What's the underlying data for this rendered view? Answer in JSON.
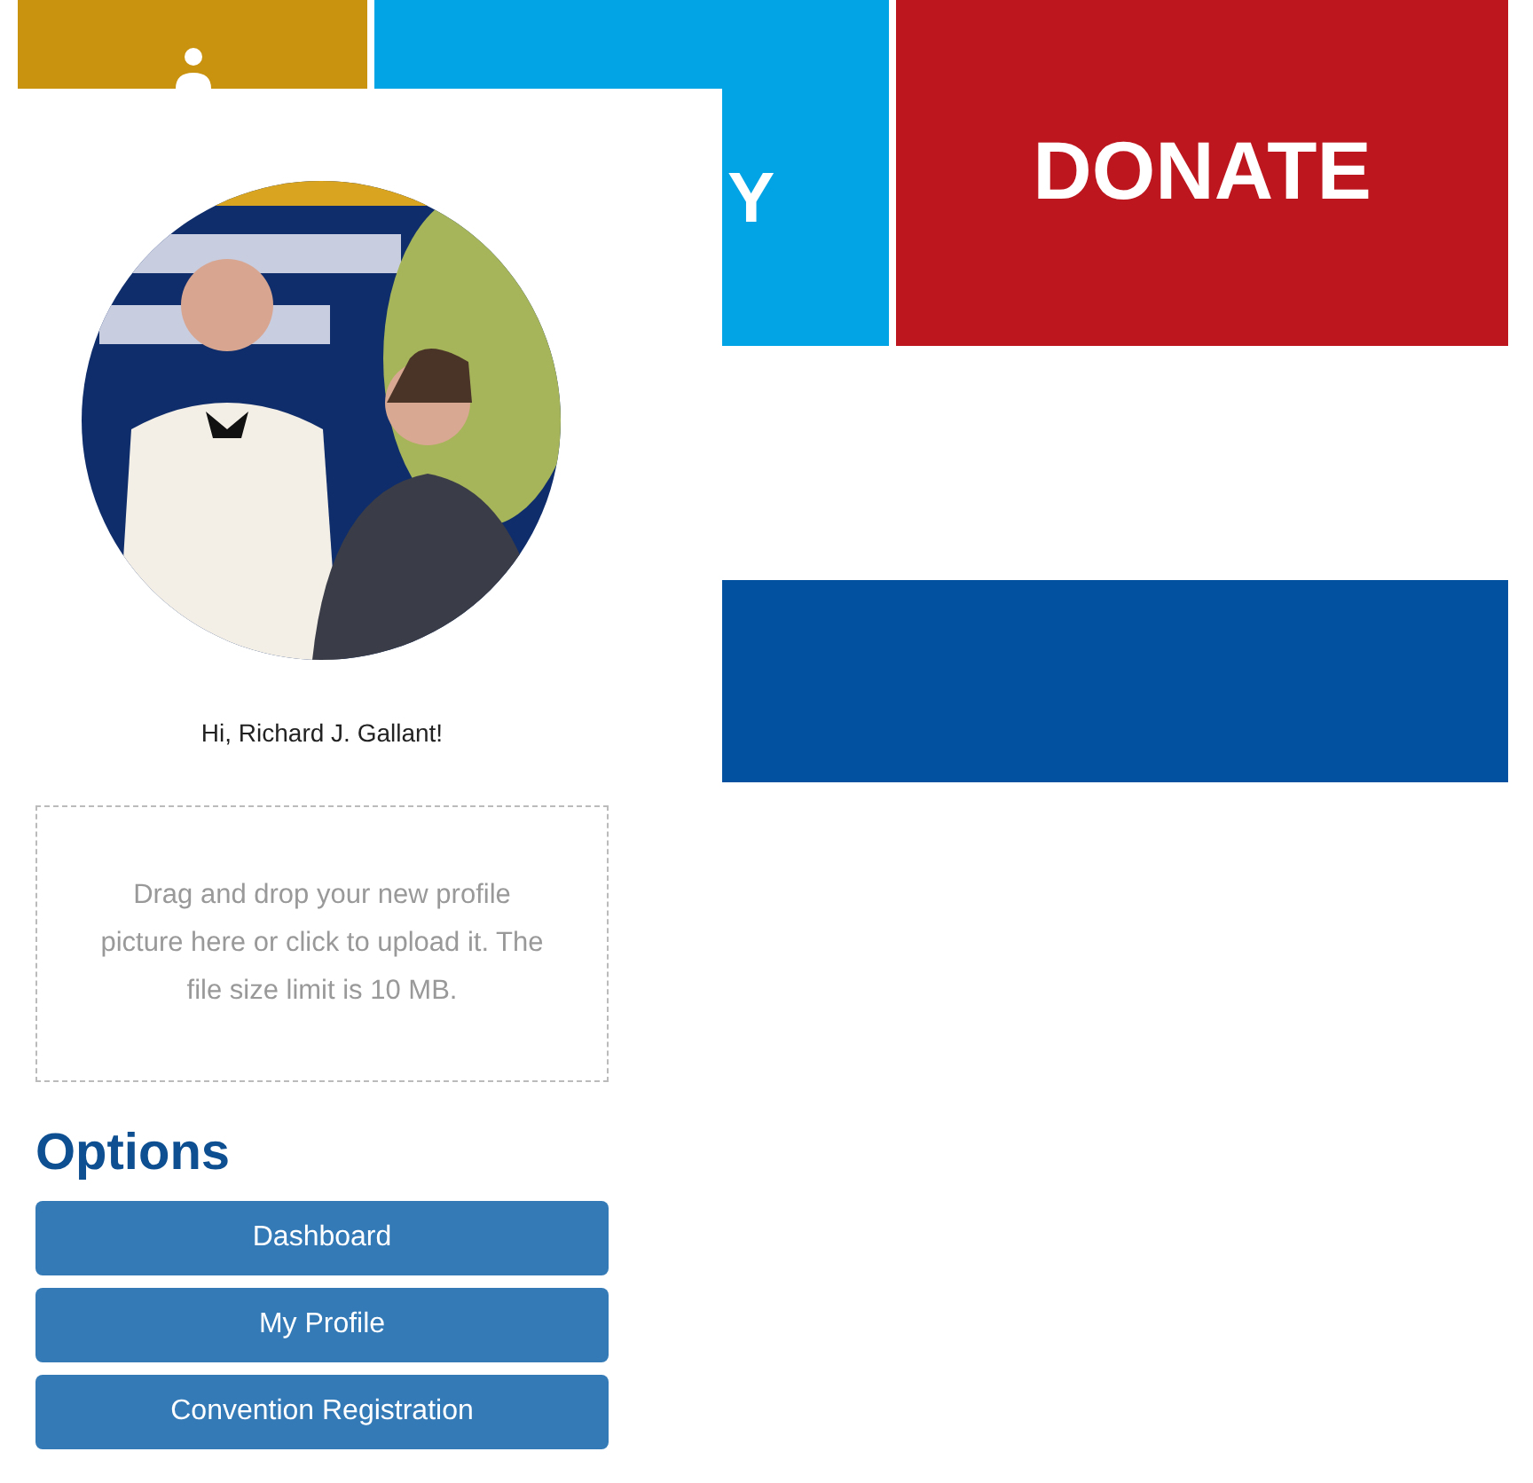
{
  "tiles": [
    {
      "kind": "icon",
      "color": "#c9930f"
    },
    {
      "kind": "text",
      "color": "#03a4e6",
      "text": "Y"
    },
    {
      "kind": "text",
      "color": "#bd161e",
      "text": "DONATE"
    }
  ],
  "panel": {
    "greeting": "Hi, Richard J. Gallant!",
    "upload_hint": "Drag and drop your new profile picture here or click to upload it. The file size limit is 10 MB.",
    "options_title": "Options",
    "buttons": [
      "Dashboard",
      "My Profile",
      "Convention Registration"
    ]
  }
}
